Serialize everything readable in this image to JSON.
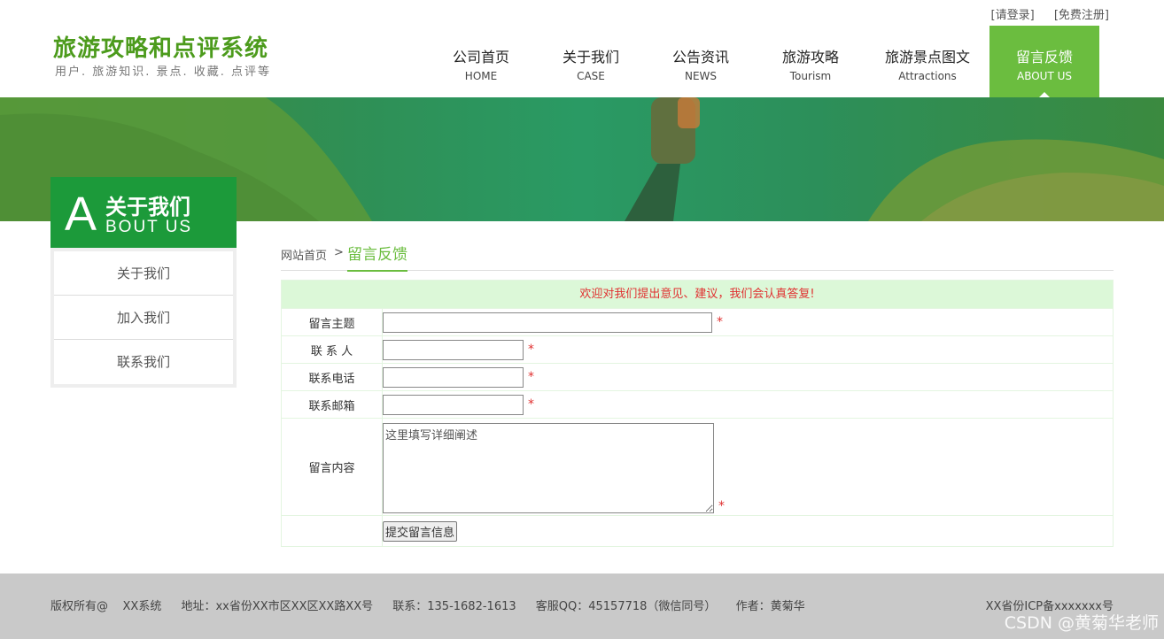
{
  "top_links": {
    "login": "[请登录]",
    "register": "[免费注册]"
  },
  "logo": {
    "title": "旅游攻略和点评系统",
    "subtitle": "用户. 旅游知识. 景点. 收藏. 点评等"
  },
  "nav": [
    {
      "cn": "公司首页",
      "en": "HOME"
    },
    {
      "cn": "关于我们",
      "en": "CASE"
    },
    {
      "cn": "公告资讯",
      "en": "NEWS"
    },
    {
      "cn": "旅游攻略",
      "en": "Tourism"
    },
    {
      "cn": "旅游景点图文",
      "en": "Attractions"
    },
    {
      "cn": "留言反馈",
      "en": "ABOUT US"
    }
  ],
  "sidebar": {
    "title_letter": "A",
    "title_cn": "关于我们",
    "title_en": "BOUT  US",
    "items": [
      "关于我们",
      "加入我们",
      "联系我们"
    ]
  },
  "breadcrumb": {
    "home": "网站首页",
    "sep": ">",
    "current": "留言反馈"
  },
  "form": {
    "notice": "欢迎对我们提出意见、建议，我们会认真答复!",
    "subject_label": "留言主题",
    "contact_label": "联 系 人",
    "phone_label": "联系电话",
    "email_label": "联系邮箱",
    "content_label": "留言内容",
    "content_placeholder": "这里填写详细阐述",
    "required_mark": "*",
    "submit_label": "提交留言信息"
  },
  "footer": {
    "copyright": "版权所有@    XX系统",
    "address": "地址：xx省份XX市区XX区XX路XX号",
    "phone": "联系：135-1682-1613",
    "qq": "客服QQ：45157718（微信同号）",
    "author": "作者：黄菊华",
    "icp": "XX省份ICP备xxxxxxx号"
  },
  "watermark": "CSDN @黄菊华老师",
  "colors": {
    "brand_green": "#6bbd3f",
    "sidebar_green": "#1c9a3a",
    "notice_bg": "#dcf8d8",
    "alert_red": "#e03030"
  }
}
